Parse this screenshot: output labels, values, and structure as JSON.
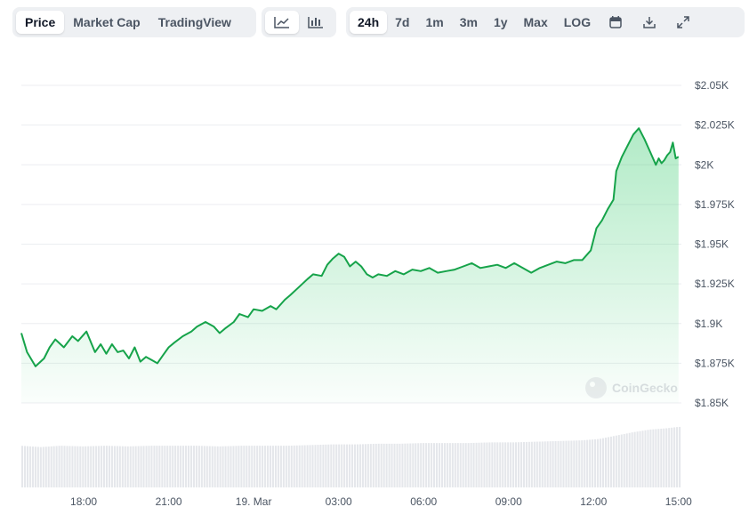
{
  "toolbar": {
    "metric_tabs": [
      "Price",
      "Market Cap",
      "TradingView"
    ],
    "active_metric": "Price",
    "chart_style_icons": [
      "line-chart-icon",
      "candlestick-chart-icon"
    ],
    "active_style": "line-chart-icon",
    "range_tabs": [
      "24h",
      "7d",
      "1m",
      "3m",
      "1y",
      "Max",
      "LOG"
    ],
    "active_range": "24h",
    "tool_icons": [
      "calendar-icon",
      "download-icon",
      "expand-icon"
    ]
  },
  "watermark": "CoinGecko",
  "colors": {
    "line": "#16a34a",
    "fill_top": "#22c55e",
    "volume": "#e5e7eb",
    "grid": "#eceef1",
    "text": "#4b5563"
  },
  "chart_data": {
    "type": "area",
    "title": "",
    "xlabel": "",
    "ylabel": "",
    "y_ticks": [
      1850,
      1875,
      1900,
      1925,
      1950,
      1975,
      2000,
      2025,
      2050
    ],
    "y_tick_labels": [
      "$1.85K",
      "$1.875K",
      "$1.9K",
      "$1.925K",
      "$1.95K",
      "$1.975K",
      "$2K",
      "$2.025K",
      "$2.05K"
    ],
    "ylim": [
      1850,
      2050
    ],
    "x_ticks": [
      18,
      21,
      24,
      27,
      30,
      33,
      36,
      39
    ],
    "x_tick_labels": [
      "18:00",
      "21:00",
      "19. Mar",
      "03:00",
      "06:00",
      "09:00",
      "12:00",
      "15:00"
    ],
    "xlim": [
      15.8,
      39.1
    ],
    "grid": true,
    "series": [
      {
        "type": "area",
        "x": [
          15.8,
          16.0,
          16.3,
          16.6,
          16.8,
          17.0,
          17.3,
          17.6,
          17.8,
          18.0,
          18.1,
          18.4,
          18.6,
          18.8,
          19.0,
          19.2,
          19.4,
          19.6,
          19.8,
          20.0,
          20.2,
          20.4,
          20.6,
          20.8,
          21.0,
          21.2,
          21.5,
          21.8,
          22.0,
          22.3,
          22.6,
          22.8,
          23.0,
          23.3,
          23.5,
          23.8,
          24.0,
          24.3,
          24.6,
          24.8,
          25.1,
          25.3,
          25.6,
          25.9,
          26.1,
          26.4,
          26.6,
          26.8,
          27.0,
          27.2,
          27.4,
          27.6,
          27.8,
          28.0,
          28.2,
          28.4,
          28.7,
          29.0,
          29.3,
          29.6,
          29.9,
          30.2,
          30.5,
          30.8,
          31.1,
          31.4,
          31.7,
          32.0,
          32.3,
          32.6,
          32.9,
          33.2,
          33.5,
          33.8,
          34.1,
          34.4,
          34.7,
          35.0,
          35.3,
          35.6,
          35.9,
          36.1,
          36.3,
          36.5,
          36.7,
          36.8,
          37.0,
          37.2,
          37.4,
          37.6,
          37.8,
          38.0,
          38.2,
          38.3,
          38.4,
          38.5,
          38.6,
          38.7,
          38.8,
          38.9,
          39.0
        ],
        "values": [
          1894,
          1882,
          1873,
          1878,
          1885,
          1890,
          1885,
          1892,
          1889,
          1893,
          1895,
          1882,
          1887,
          1881,
          1887,
          1882,
          1883,
          1878,
          1885,
          1876,
          1879,
          1877,
          1875,
          1880,
          1885,
          1888,
          1892,
          1895,
          1898,
          1901,
          1898,
          1894,
          1897,
          1901,
          1906,
          1904,
          1909,
          1908,
          1911,
          1909,
          1915,
          1918,
          1923,
          1928,
          1931,
          1930,
          1937,
          1941,
          1944,
          1942,
          1936,
          1939,
          1936,
          1931,
          1929,
          1931,
          1930,
          1933,
          1931,
          1934,
          1933,
          1935,
          1932,
          1933,
          1934,
          1936,
          1938,
          1935,
          1936,
          1937,
          1935,
          1938,
          1935,
          1932,
          1935,
          1937,
          1939,
          1938,
          1940,
          1940,
          1946,
          1960,
          1965,
          1972,
          1978,
          1996,
          2005,
          2012,
          2019,
          2023,
          2016,
          2008,
          2000,
          2004,
          2001,
          2003,
          2006,
          2008,
          2014,
          2004,
          2005
        ]
      },
      {
        "type": "bar",
        "name": "",
        "note_values": "relative volume",
        "x": [
          15.8,
          16.5,
          17.2,
          18.0,
          18.8,
          19.6,
          20.4,
          21.2,
          22.0,
          22.8,
          23.6,
          24.4,
          25.2,
          26.0,
          26.8,
          27.6,
          28.4,
          29.2,
          30.0,
          30.8,
          31.6,
          32.4,
          33.2,
          34.0,
          34.8,
          35.6,
          36.2,
          36.8,
          37.4,
          38.0,
          38.6,
          39.0
        ],
        "values": [
          0.62,
          0.6,
          0.62,
          0.61,
          0.62,
          0.61,
          0.62,
          0.62,
          0.62,
          0.61,
          0.62,
          0.62,
          0.62,
          0.63,
          0.64,
          0.64,
          0.65,
          0.65,
          0.66,
          0.66,
          0.66,
          0.67,
          0.67,
          0.68,
          0.69,
          0.7,
          0.72,
          0.77,
          0.82,
          0.86,
          0.88,
          0.9
        ]
      }
    ]
  }
}
